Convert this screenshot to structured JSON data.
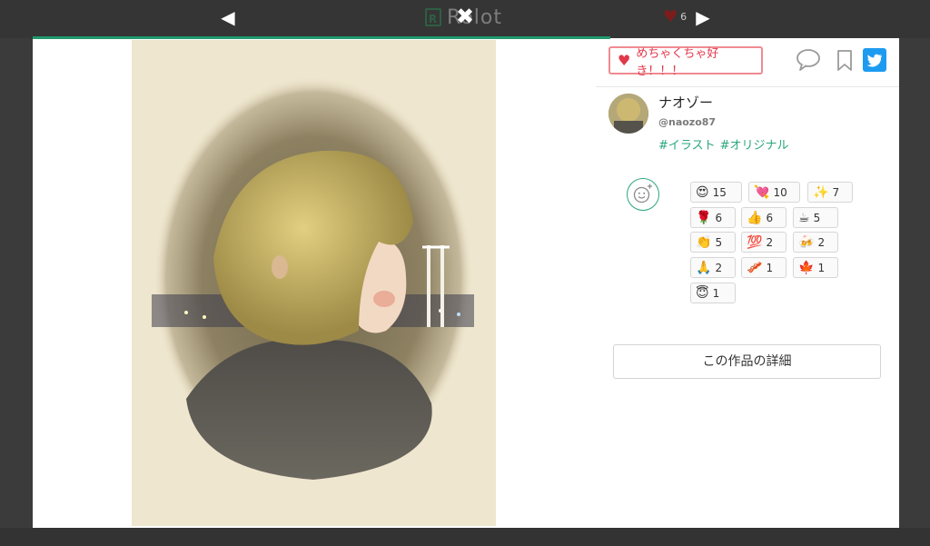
{
  "topbar": {
    "logo_text": "Rolot",
    "prev_glyph": "◀",
    "next_glyph": "▶",
    "close_glyph": "✖",
    "like_count": "6"
  },
  "colors": {
    "accent": "#1f9a6d",
    "tag_green": "#2aa77c",
    "love_red": "#e2384b",
    "twitter_blue": "#1d9bf0"
  },
  "panel": {
    "love_button": "めちゃくちゃ好き！！！",
    "user": {
      "name": "ナオゾー",
      "handle": "@naozo87"
    },
    "tags": [
      "#イラスト",
      "#オリジナル"
    ],
    "reactions": [
      {
        "emoji": "😍",
        "count": "15"
      },
      {
        "emoji": "💘",
        "count": "10"
      },
      {
        "emoji": "✨",
        "count": "7"
      },
      {
        "emoji": "🌹",
        "count": "6"
      },
      {
        "emoji": "👍",
        "count": "6"
      },
      {
        "emoji": "☕",
        "count": "5"
      },
      {
        "emoji": "👏",
        "count": "5"
      },
      {
        "emoji": "💯",
        "count": "2"
      },
      {
        "emoji": "🍻",
        "count": "2"
      },
      {
        "emoji": "🙏",
        "count": "2"
      },
      {
        "emoji": "🥓",
        "count": "1"
      },
      {
        "emoji": "🍁",
        "count": "1"
      },
      {
        "emoji": "😇",
        "count": "1"
      }
    ],
    "detail_button": "この作品の詳細"
  }
}
